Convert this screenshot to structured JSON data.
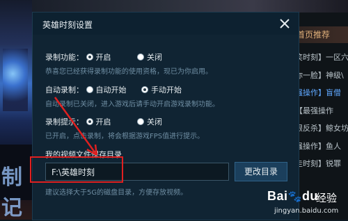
{
  "right_panel": {
    "title": "首页推荐",
    "items": [
      {
        "text": "笑时刻】一区六",
        "highlight": false
      },
      {
        "text": "你一脸】神级\\",
        "highlight": false
      },
      {
        "text": "强操作】盲僧",
        "highlight": true
      },
      {
        "text": "【最强操作",
        "highlight": false
      },
      {
        "text": "限反杀】鲸女坊",
        "highlight": false
      },
      {
        "text": "强操作】鱼人",
        "highlight": false
      },
      {
        "text": "走时刻】锐罪",
        "highlight": false
      }
    ]
  },
  "background": {
    "left_text": "制记"
  },
  "dialog": {
    "title": "英雄时刻设置",
    "close_icon": "close-icon",
    "record_function": {
      "label": "录制功能：",
      "options": [
        "开启",
        "关闭"
      ],
      "selected": "开启",
      "desc": "恭喜您已经获得录制功能的使用资格，现已为你启用。"
    },
    "auto_record": {
      "label": "自动录制：",
      "options": [
        "自动开始",
        "手动开始"
      ],
      "selected": "手动开始",
      "desc": "自动录制已关闭，进入游戏后请手动开启游戏录制功能。"
    },
    "record_hint": {
      "label": "录制提示：",
      "options": [
        "开启",
        "关闭"
      ],
      "selected": "开启",
      "desc": "已开启，点击录制，将会根据游戏FPS值进行提示。"
    },
    "video_dir": {
      "label": "我的视频文件保存目录",
      "value": "F:\\英雄时刻",
      "change_button": "更改目录",
      "hint": "建议选择大于5G的磁盘目录，方便存放视频。"
    }
  },
  "annotation": {
    "color": "#e02020"
  },
  "watermark": {
    "logo": "Bai",
    "logo_mark": "du",
    "suffix": "经验",
    "url": "jingyan.baidu.com"
  }
}
